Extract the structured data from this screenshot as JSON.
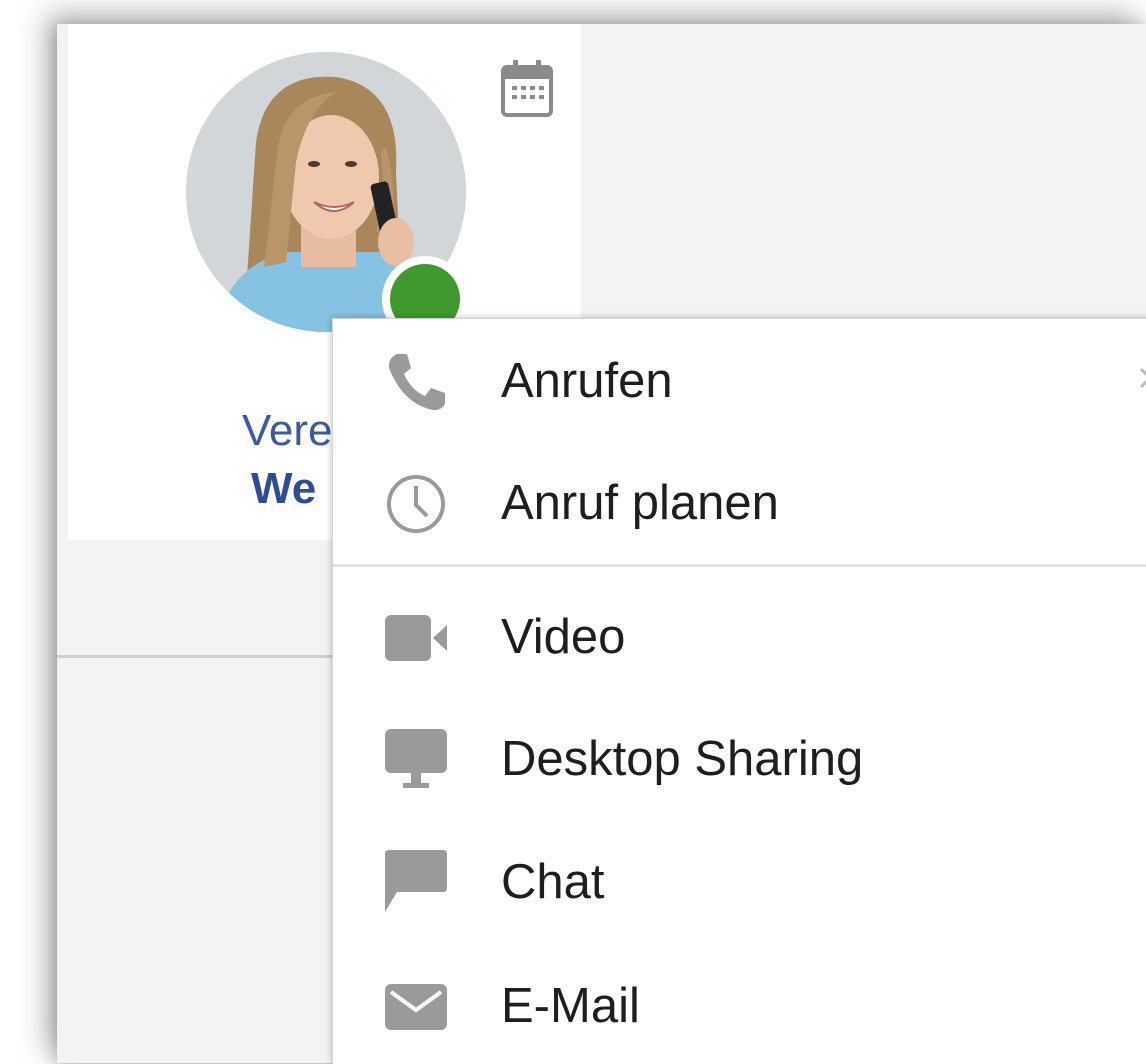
{
  "contact": {
    "first_name_visible": "Vere",
    "last_name_visible": "We",
    "presence": "online",
    "presence_color": "#3e9a2d",
    "name_color": "#3c5aa0"
  },
  "header": {
    "calendar_icon": "calendar-icon"
  },
  "menu": {
    "items": [
      {
        "label": "Anrufen",
        "icon": "phone-icon"
      },
      {
        "label": "Anruf planen",
        "icon": "clock-icon"
      },
      {
        "label": "Video",
        "icon": "video-camera-icon"
      },
      {
        "label": "Desktop Sharing",
        "icon": "monitor-icon"
      },
      {
        "label": "Chat",
        "icon": "chat-bubble-icon"
      },
      {
        "label": "E-Mail",
        "icon": "envelope-icon"
      }
    ],
    "icon_color": "#9a9a9a"
  }
}
